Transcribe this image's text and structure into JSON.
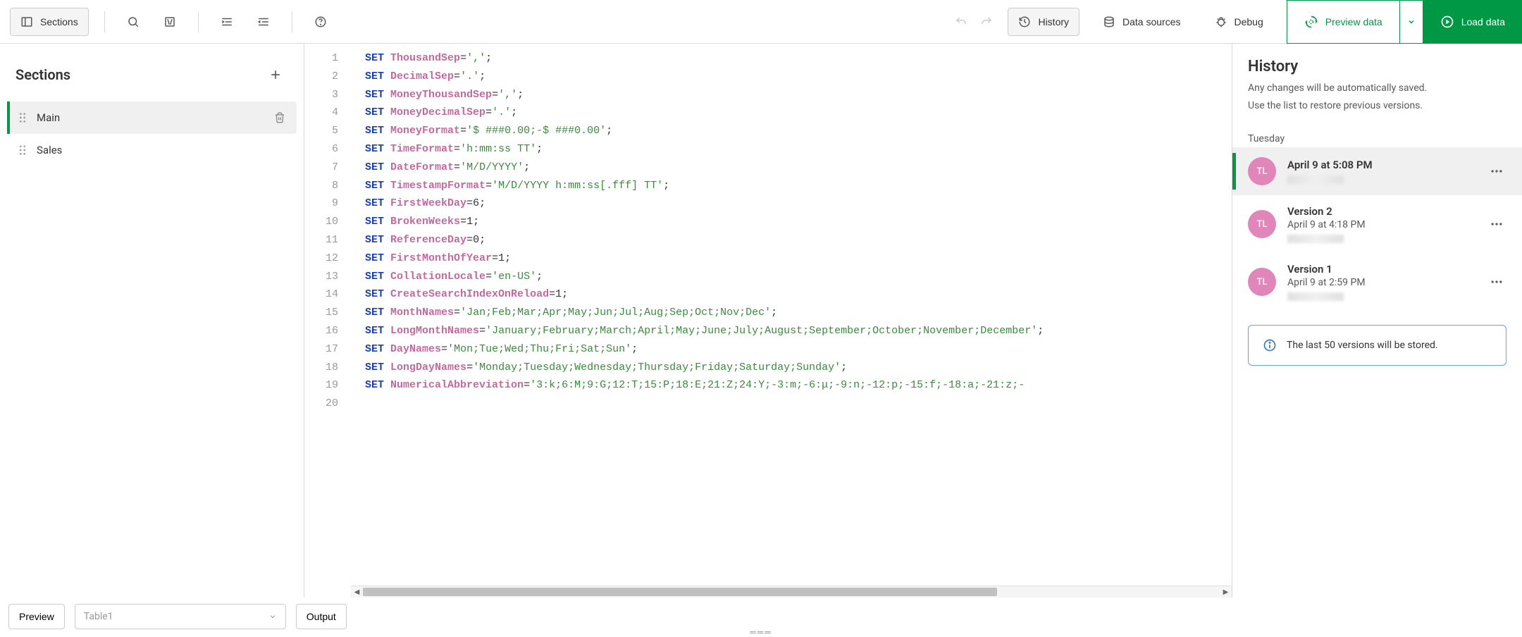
{
  "toolbar": {
    "sections_label": "Sections",
    "history_label": "History",
    "data_sources_label": "Data sources",
    "debug_label": "Debug",
    "preview_data_label": "Preview data",
    "load_data_label": "Load data"
  },
  "sidebar": {
    "title": "Sections",
    "items": [
      {
        "name": "Main",
        "active": true
      },
      {
        "name": "Sales",
        "active": false
      }
    ]
  },
  "code_lines": [
    {
      "kw": "SET",
      "var": "ThousandSep",
      "op": "=",
      "val": "','",
      "end": ";"
    },
    {
      "kw": "SET",
      "var": "DecimalSep",
      "op": "=",
      "val": "'.'",
      "end": ";"
    },
    {
      "kw": "SET",
      "var": "MoneyThousandSep",
      "op": "=",
      "val": "','",
      "end": ";"
    },
    {
      "kw": "SET",
      "var": "MoneyDecimalSep",
      "op": "=",
      "val": "'.'",
      "end": ";"
    },
    {
      "kw": "SET",
      "var": "MoneyFormat",
      "op": "=",
      "val": "'$ ###0.00;-$ ###0.00'",
      "end": ";"
    },
    {
      "kw": "SET",
      "var": "TimeFormat",
      "op": "=",
      "val": "'h:mm:ss TT'",
      "end": ";"
    },
    {
      "kw": "SET",
      "var": "DateFormat",
      "op": "=",
      "val": "'M/D/YYYY'",
      "end": ";"
    },
    {
      "kw": "SET",
      "var": "TimestampFormat",
      "op": "=",
      "val": "'M/D/YYYY h:mm:ss[.fff] TT'",
      "end": ";"
    },
    {
      "kw": "SET",
      "var": "FirstWeekDay",
      "op": "=",
      "val": "6",
      "end": ";",
      "type": "num"
    },
    {
      "kw": "SET",
      "var": "BrokenWeeks",
      "op": "=",
      "val": "1",
      "end": ";",
      "type": "num"
    },
    {
      "kw": "SET",
      "var": "ReferenceDay",
      "op": "=",
      "val": "0",
      "end": ";",
      "type": "num"
    },
    {
      "kw": "SET",
      "var": "FirstMonthOfYear",
      "op": "=",
      "val": "1",
      "end": ";",
      "type": "num"
    },
    {
      "kw": "SET",
      "var": "CollationLocale",
      "op": "=",
      "val": "'en-US'",
      "end": ";"
    },
    {
      "kw": "SET",
      "var": "CreateSearchIndexOnReload",
      "op": "=",
      "val": "1",
      "end": ";",
      "type": "num"
    },
    {
      "kw": "SET",
      "var": "MonthNames",
      "op": "=",
      "val": "'Jan;Feb;Mar;Apr;May;Jun;Jul;Aug;Sep;Oct;Nov;Dec'",
      "end": ";"
    },
    {
      "kw": "SET",
      "var": "LongMonthNames",
      "op": "=",
      "val": "'January;February;March;April;May;June;July;August;September;October;November;December'",
      "end": ";"
    },
    {
      "kw": "SET",
      "var": "DayNames",
      "op": "=",
      "val": "'Mon;Tue;Wed;Thu;Fri;Sat;Sun'",
      "end": ";"
    },
    {
      "kw": "SET",
      "var": "LongDayNames",
      "op": "=",
      "val": "'Monday;Tuesday;Wednesday;Thursday;Friday;Saturday;Sunday'",
      "end": ";"
    },
    {
      "kw": "SET",
      "var": "NumericalAbbreviation",
      "op": "=",
      "val": "'3:k;6:M;9:G;12:T;15:P;18:E;21:Z;24:Y;-3:m;-6:μ;-9:n;-12:p;-15:f;-18:a;-21:z;-",
      "end": ""
    }
  ],
  "line_count": 20,
  "history": {
    "title": "History",
    "desc1": "Any changes will be automatically saved.",
    "desc2": "Use the list to restore previous versions.",
    "day_label": "Tuesday",
    "versions": [
      {
        "name": "April 9 at 5:08 PM",
        "time": "",
        "initials": "TL",
        "active": true
      },
      {
        "name": "Version 2",
        "time": "April 9 at 4:18 PM",
        "initials": "TL",
        "active": false
      },
      {
        "name": "Version 1",
        "time": "April 9 at 2:59 PM",
        "initials": "TL",
        "active": false
      }
    ],
    "info_text": "The last 50 versions will be stored."
  },
  "bottom": {
    "preview_label": "Preview",
    "table_placeholder": "Table1",
    "output_label": "Output"
  }
}
